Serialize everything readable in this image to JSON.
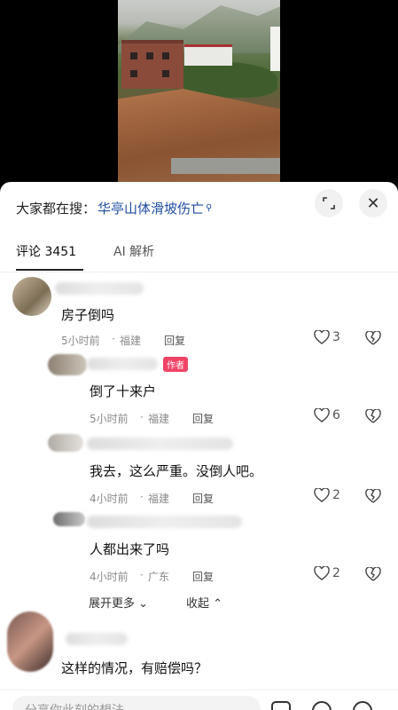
{
  "search": {
    "prefix": "大家都在搜：",
    "term": "华亭山体滑坡伤亡",
    "icon": "search-icon"
  },
  "tabs": [
    {
      "label": "评论 3451",
      "active": true
    },
    {
      "label": "AI 解析",
      "active": false
    }
  ],
  "comments": [
    {
      "text": "房子倒吗",
      "time": "5小时前",
      "location": "福建",
      "reply": "回复",
      "likes": "3"
    },
    {
      "text": "倒了十来户",
      "time": "5小时前",
      "location": "福建",
      "reply": "回复",
      "likes": "6",
      "badge": "作者"
    },
    {
      "text": "我去，这么严重。没倒人吧。",
      "time": "4小时前",
      "location": "福建",
      "reply": "回复",
      "likes": "2"
    },
    {
      "text": "人都出来了吗",
      "time": "4小时前",
      "location": "广东",
      "reply": "回复",
      "likes": "2"
    },
    {
      "text": "这样的情况，有赔偿吗？"
    }
  ],
  "more": {
    "expand": "展开更多",
    "collapse": "收起"
  },
  "input": {
    "placeholder": "分享你此刻的想法"
  }
}
